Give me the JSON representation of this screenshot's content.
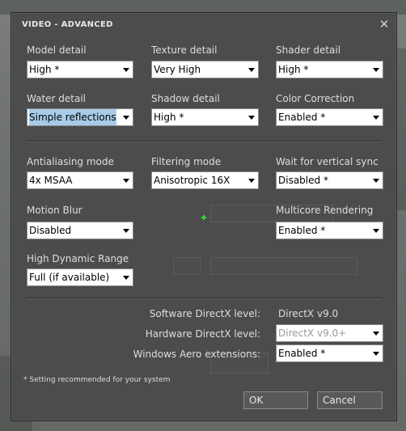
{
  "dialog": {
    "title": "VIDEO - ADVANCED",
    "close_glyph": "✕",
    "settings": {
      "model_detail": {
        "label": "Model detail",
        "value": "High *"
      },
      "texture_detail": {
        "label": "Texture detail",
        "value": "Very High"
      },
      "shader_detail": {
        "label": "Shader detail",
        "value": "High *"
      },
      "water_detail": {
        "label": "Water detail",
        "value": "Simple reflections"
      },
      "shadow_detail": {
        "label": "Shadow detail",
        "value": "High *"
      },
      "color_correction": {
        "label": "Color Correction",
        "value": "Enabled *"
      },
      "antialiasing_mode": {
        "label": "Antialiasing mode",
        "value": "4x MSAA"
      },
      "filtering_mode": {
        "label": "Filtering mode",
        "value": "Anisotropic 16X"
      },
      "vertical_sync": {
        "label": "Wait for vertical sync",
        "value": "Disabled *"
      },
      "motion_blur": {
        "label": "Motion Blur",
        "value": "Disabled"
      },
      "multicore_rendering": {
        "label": "Multicore Rendering",
        "value": "Enabled *"
      },
      "hdr": {
        "label": "High Dynamic Range",
        "value": "Full (if available)"
      }
    },
    "info": {
      "software_dx_label": "Software DirectX level:",
      "software_dx_value": "DirectX v9.0",
      "hardware_dx_label": "Hardware DirectX level:",
      "hardware_dx_value": "DirectX v9.0+",
      "aero_label": "Windows Aero extensions:",
      "aero_value": "Enabled *"
    },
    "footnote": "* Setting recommended for your system",
    "buttons": {
      "ok": "OK",
      "cancel": "Cancel"
    }
  }
}
